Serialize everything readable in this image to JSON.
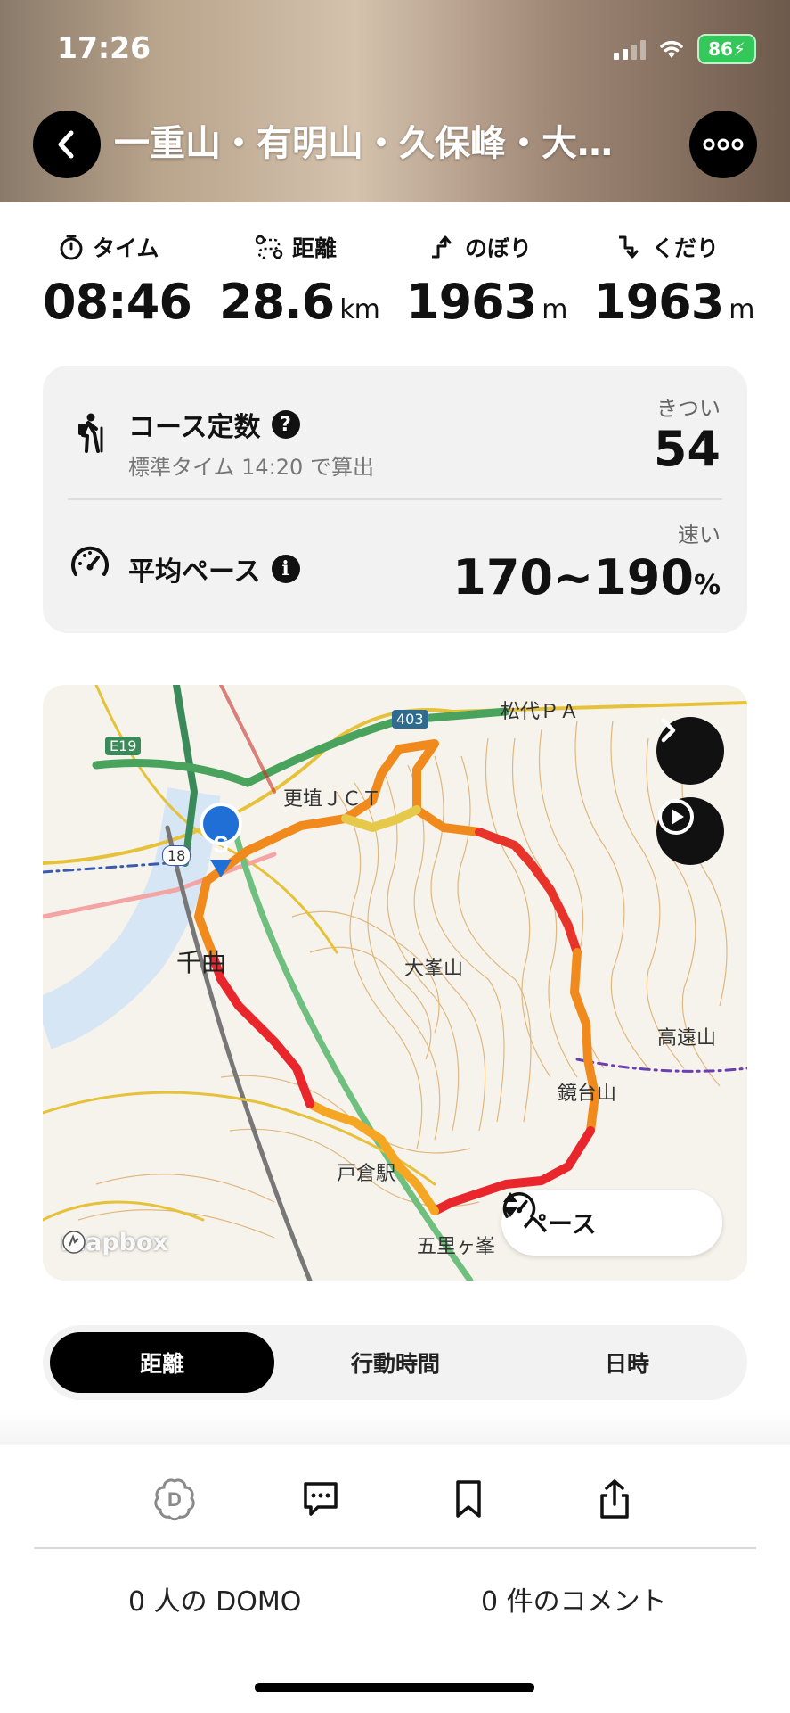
{
  "status_bar": {
    "time": "17:26",
    "battery": "86"
  },
  "header": {
    "title": "一重山・有明山・久保峰・大…"
  },
  "stats": [
    {
      "label": "タイム",
      "value": "08:46",
      "unit": ""
    },
    {
      "label": "距離",
      "value": "28.6",
      "unit": "km"
    },
    {
      "label": "のぼり",
      "value": "1963",
      "unit": "m"
    },
    {
      "label": "くだり",
      "value": "1963",
      "unit": "m"
    }
  ],
  "course": {
    "title": "コース定数",
    "subtitle": "標準タイム 14:20 で算出",
    "level": "きつい",
    "value": "54"
  },
  "pace": {
    "title": "平均ペース",
    "level": "速い",
    "value": "170~190",
    "unit": "%"
  },
  "map": {
    "start_marker": "S",
    "pace_pill": "ペース",
    "attribution": "mapbox",
    "labels": [
      "千曲",
      "大峯山",
      "松代ＰＡ",
      "更埴ＪＣＴ",
      "戸倉駅",
      "五里ヶ峯",
      "高遠山",
      "鏡台山",
      "403",
      "E19",
      "18"
    ]
  },
  "tabs": [
    "距離",
    "行動時間",
    "日時"
  ],
  "social": {
    "domo": "0 人の DOMO",
    "comments": "0 件のコメント"
  },
  "colors": {
    "accent": "#000000",
    "route_fast": "#e8262b",
    "route_mid": "#f08a1c",
    "route_slow": "#e6c84a",
    "marker": "#1f6fd6"
  }
}
